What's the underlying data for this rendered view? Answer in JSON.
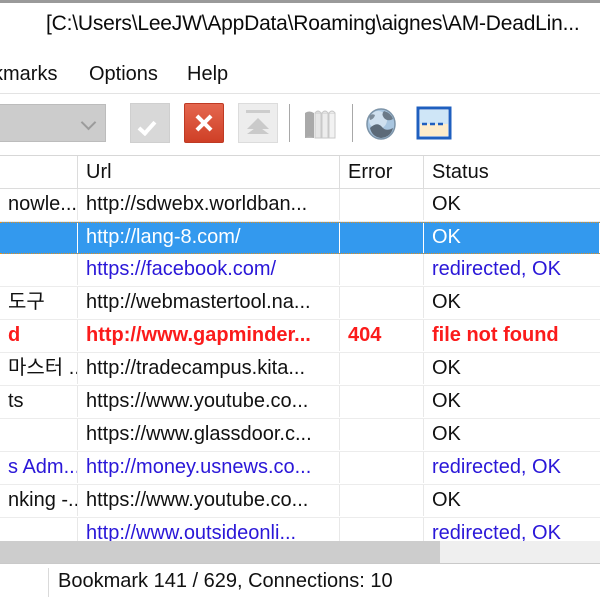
{
  "window": {
    "title": "[C:\\Users\\LeeJW\\AppData\\Roaming\\aignes\\AM-DeadLin..."
  },
  "menu": {
    "items": [
      {
        "label": "kmarks"
      },
      {
        "label": "Options"
      },
      {
        "label": "Help"
      }
    ]
  },
  "toolbar": {
    "combo_value": "",
    "buttons": [
      {
        "name": "check-button",
        "icon": "check-icon",
        "enabled": false
      },
      {
        "name": "stop-button",
        "icon": "close-x-icon",
        "enabled": true
      },
      {
        "name": "move-up-button",
        "icon": "up-arrow-icon",
        "enabled": false
      },
      {
        "name": "bookmarks-button",
        "icon": "books-icon",
        "enabled": false
      },
      {
        "name": "open-in-browser-button",
        "icon": "globe-icon",
        "enabled": true
      },
      {
        "name": "report-button",
        "icon": "report-window-icon",
        "enabled": true
      }
    ]
  },
  "grid": {
    "columns": [
      {
        "key": "title",
        "label": ""
      },
      {
        "key": "url",
        "label": "Url"
      },
      {
        "key": "error",
        "label": "Error"
      },
      {
        "key": "status",
        "label": "Status"
      }
    ],
    "rows": [
      {
        "title": "nowle...",
        "url": "http://sdwebx.worldban...",
        "error": "",
        "status": "OK",
        "color": "black",
        "selected": false
      },
      {
        "title": "",
        "url": "http://lang-8.com/",
        "error": "",
        "status": "OK",
        "color": "blue",
        "selected": true
      },
      {
        "title": "",
        "url": "https://facebook.com/",
        "error": "",
        "status": "redirected, OK",
        "color": "blue",
        "selected": false
      },
      {
        "title": "도구",
        "url": "http://webmastertool.na...",
        "error": "",
        "status": "OK",
        "color": "black",
        "selected": false
      },
      {
        "title": "d",
        "url": "http://www.gapminder...",
        "error": "404",
        "status": "file not found",
        "color": "red",
        "selected": false
      },
      {
        "title": "마스터 ...",
        "url": "http://tradecampus.kita...",
        "error": "",
        "status": "OK",
        "color": "black",
        "selected": false
      },
      {
        "title": "ts",
        "url": "https://www.youtube.co...",
        "error": "",
        "status": "OK",
        "color": "black",
        "selected": false
      },
      {
        "title": "",
        "url": "https://www.glassdoor.c...",
        "error": "",
        "status": "OK",
        "color": "black",
        "selected": false
      },
      {
        "title": "s Adm...",
        "url": "http://money.usnews.co...",
        "error": "",
        "status": "redirected, OK",
        "color": "blue",
        "selected": false
      },
      {
        "title": "nking -...",
        "url": "https://www.youtube.co...",
        "error": "",
        "status": "OK",
        "color": "black",
        "selected": false
      },
      {
        "title": "",
        "url": "http://www.outsideonli...",
        "error": "",
        "status": "redirected, OK",
        "color": "blue",
        "selected": false
      }
    ]
  },
  "statusbar": {
    "text": "Bookmark 141 / 629, Connections: 10"
  },
  "colors": {
    "selection_blue": "#3399ee",
    "link_blue": "#2a17d8",
    "error_red": "#fb1b1b",
    "text_black": "#111111",
    "focus_orange": "#e09020"
  }
}
